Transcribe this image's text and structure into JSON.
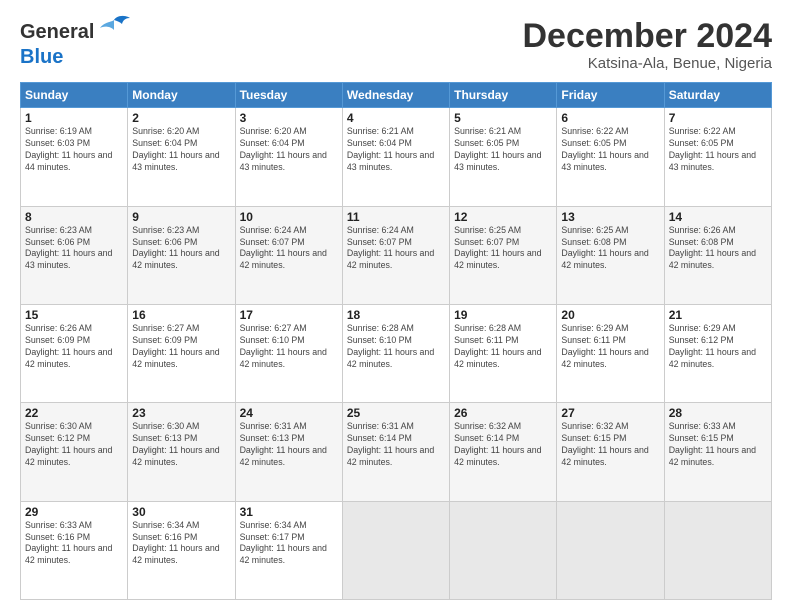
{
  "header": {
    "logo_general": "General",
    "logo_blue": "Blue",
    "month_title": "December 2024",
    "location": "Katsina-Ala, Benue, Nigeria"
  },
  "days_of_week": [
    "Sunday",
    "Monday",
    "Tuesday",
    "Wednesday",
    "Thursday",
    "Friday",
    "Saturday"
  ],
  "weeks": [
    [
      {
        "day": "1",
        "sunrise": "6:19 AM",
        "sunset": "6:03 PM",
        "daylight": "11 hours and 44 minutes."
      },
      {
        "day": "2",
        "sunrise": "6:20 AM",
        "sunset": "6:04 PM",
        "daylight": "11 hours and 43 minutes."
      },
      {
        "day": "3",
        "sunrise": "6:20 AM",
        "sunset": "6:04 PM",
        "daylight": "11 hours and 43 minutes."
      },
      {
        "day": "4",
        "sunrise": "6:21 AM",
        "sunset": "6:04 PM",
        "daylight": "11 hours and 43 minutes."
      },
      {
        "day": "5",
        "sunrise": "6:21 AM",
        "sunset": "6:05 PM",
        "daylight": "11 hours and 43 minutes."
      },
      {
        "day": "6",
        "sunrise": "6:22 AM",
        "sunset": "6:05 PM",
        "daylight": "11 hours and 43 minutes."
      },
      {
        "day": "7",
        "sunrise": "6:22 AM",
        "sunset": "6:05 PM",
        "daylight": "11 hours and 43 minutes."
      }
    ],
    [
      {
        "day": "8",
        "sunrise": "6:23 AM",
        "sunset": "6:06 PM",
        "daylight": "11 hours and 43 minutes."
      },
      {
        "day": "9",
        "sunrise": "6:23 AM",
        "sunset": "6:06 PM",
        "daylight": "11 hours and 42 minutes."
      },
      {
        "day": "10",
        "sunrise": "6:24 AM",
        "sunset": "6:07 PM",
        "daylight": "11 hours and 42 minutes."
      },
      {
        "day": "11",
        "sunrise": "6:24 AM",
        "sunset": "6:07 PM",
        "daylight": "11 hours and 42 minutes."
      },
      {
        "day": "12",
        "sunrise": "6:25 AM",
        "sunset": "6:07 PM",
        "daylight": "11 hours and 42 minutes."
      },
      {
        "day": "13",
        "sunrise": "6:25 AM",
        "sunset": "6:08 PM",
        "daylight": "11 hours and 42 minutes."
      },
      {
        "day": "14",
        "sunrise": "6:26 AM",
        "sunset": "6:08 PM",
        "daylight": "11 hours and 42 minutes."
      }
    ],
    [
      {
        "day": "15",
        "sunrise": "6:26 AM",
        "sunset": "6:09 PM",
        "daylight": "11 hours and 42 minutes."
      },
      {
        "day": "16",
        "sunrise": "6:27 AM",
        "sunset": "6:09 PM",
        "daylight": "11 hours and 42 minutes."
      },
      {
        "day": "17",
        "sunrise": "6:27 AM",
        "sunset": "6:10 PM",
        "daylight": "11 hours and 42 minutes."
      },
      {
        "day": "18",
        "sunrise": "6:28 AM",
        "sunset": "6:10 PM",
        "daylight": "11 hours and 42 minutes."
      },
      {
        "day": "19",
        "sunrise": "6:28 AM",
        "sunset": "6:11 PM",
        "daylight": "11 hours and 42 minutes."
      },
      {
        "day": "20",
        "sunrise": "6:29 AM",
        "sunset": "6:11 PM",
        "daylight": "11 hours and 42 minutes."
      },
      {
        "day": "21",
        "sunrise": "6:29 AM",
        "sunset": "6:12 PM",
        "daylight": "11 hours and 42 minutes."
      }
    ],
    [
      {
        "day": "22",
        "sunrise": "6:30 AM",
        "sunset": "6:12 PM",
        "daylight": "11 hours and 42 minutes."
      },
      {
        "day": "23",
        "sunrise": "6:30 AM",
        "sunset": "6:13 PM",
        "daylight": "11 hours and 42 minutes."
      },
      {
        "day": "24",
        "sunrise": "6:31 AM",
        "sunset": "6:13 PM",
        "daylight": "11 hours and 42 minutes."
      },
      {
        "day": "25",
        "sunrise": "6:31 AM",
        "sunset": "6:14 PM",
        "daylight": "11 hours and 42 minutes."
      },
      {
        "day": "26",
        "sunrise": "6:32 AM",
        "sunset": "6:14 PM",
        "daylight": "11 hours and 42 minutes."
      },
      {
        "day": "27",
        "sunrise": "6:32 AM",
        "sunset": "6:15 PM",
        "daylight": "11 hours and 42 minutes."
      },
      {
        "day": "28",
        "sunrise": "6:33 AM",
        "sunset": "6:15 PM",
        "daylight": "11 hours and 42 minutes."
      }
    ],
    [
      {
        "day": "29",
        "sunrise": "6:33 AM",
        "sunset": "6:16 PM",
        "daylight": "11 hours and 42 minutes."
      },
      {
        "day": "30",
        "sunrise": "6:34 AM",
        "sunset": "6:16 PM",
        "daylight": "11 hours and 42 minutes."
      },
      {
        "day": "31",
        "sunrise": "6:34 AM",
        "sunset": "6:17 PM",
        "daylight": "11 hours and 42 minutes."
      },
      null,
      null,
      null,
      null
    ]
  ]
}
